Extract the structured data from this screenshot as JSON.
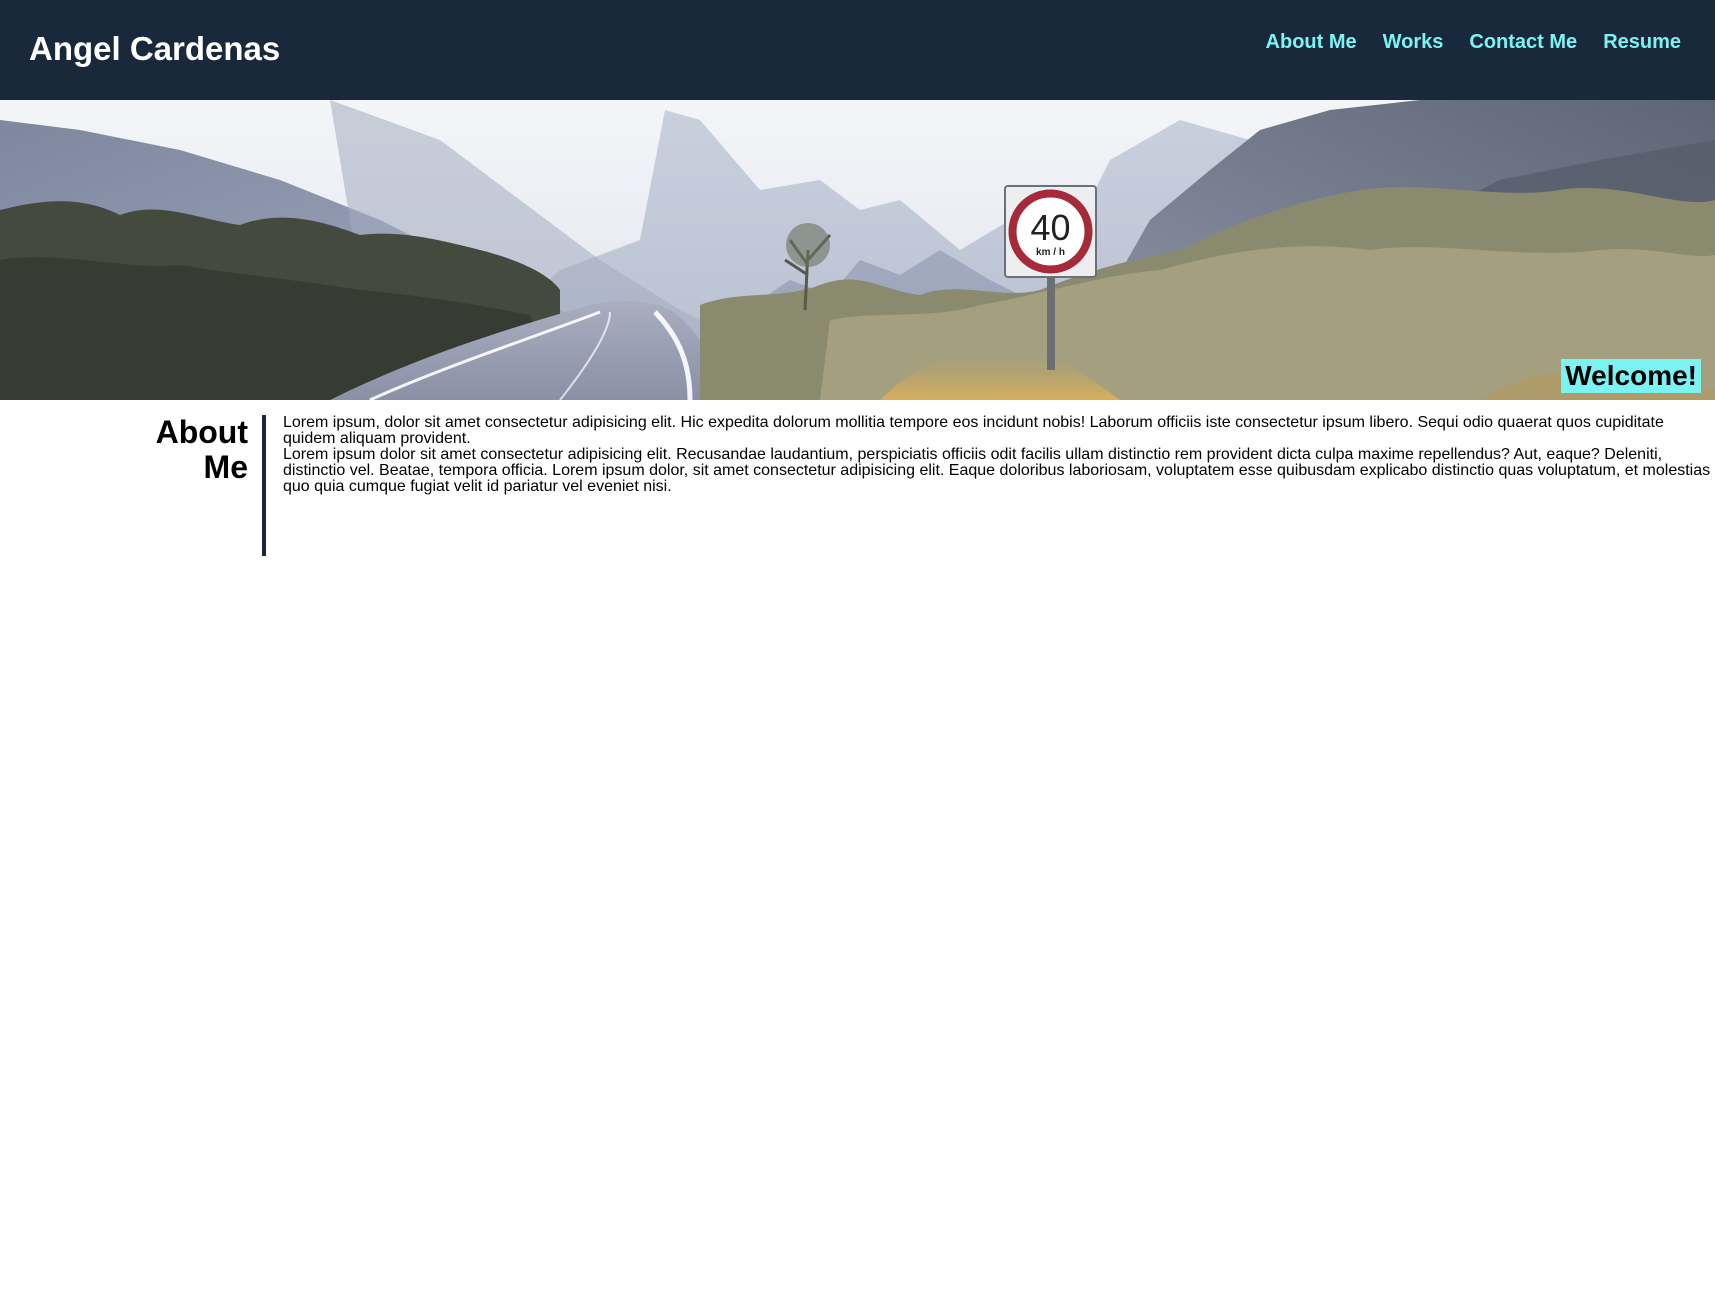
{
  "header": {
    "title": "Angel Cardenas",
    "nav": [
      "About Me",
      "Works",
      "Contact Me",
      "Resume"
    ]
  },
  "hero": {
    "welcome": "Welcome!",
    "sign": {
      "speed": "40",
      "unit": "km / h"
    }
  },
  "about": {
    "title_line1": "About",
    "title_line2": "Me",
    "paragraphs": [
      "Lorem ipsum, dolor sit amet consectetur adipisicing elit. Hic expedita dolorum mollitia tempore eos incidunt nobis! Laborum officiis iste consectetur ipsum libero. Sequi odio quaerat quos cupiditate quidem aliquam provident.",
      "Lorem ipsum dolor sit amet consectetur adipisicing elit. Recusandae laudantium, perspiciatis officiis odit facilis ullam distinctio rem provident dicta culpa maxime repellendus? Aut, eaque? Deleniti, distinctio vel. Beatae, tempora officia. Lorem ipsum dolor, sit amet consectetur adipisicing elit. Eaque doloribus laboriosam, voluptatem esse quibusdam explicabo distinctio quas voluptatum, et molestias quo quia cumque fugiat velit id pariatur vel eveniet nisi."
    ]
  },
  "colors": {
    "header_bg": "#1a283c",
    "accent": "#7cf3f3",
    "text": "#000000"
  }
}
